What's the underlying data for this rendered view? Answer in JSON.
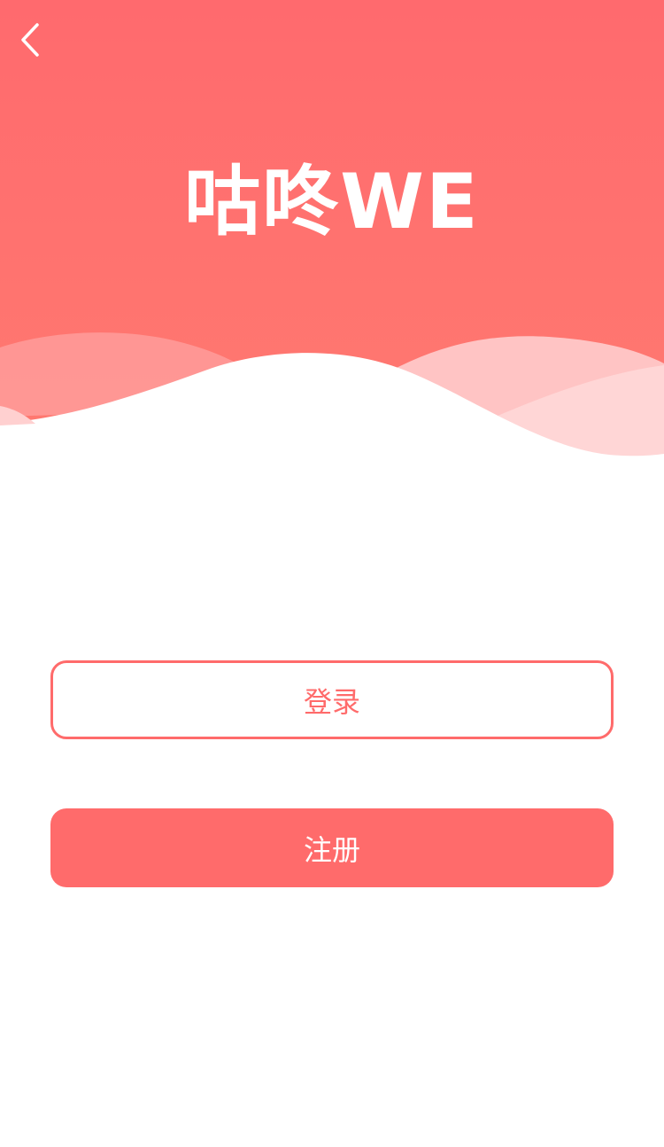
{
  "header": {
    "logo_text": "咕咚WE",
    "back_icon": "chevron-left-icon"
  },
  "actions": {
    "login_label": "登录",
    "register_label": "注册"
  },
  "colors": {
    "brand": "#ff6b6b",
    "background": "#ffffff",
    "wave_light": "#ffc4c4"
  }
}
